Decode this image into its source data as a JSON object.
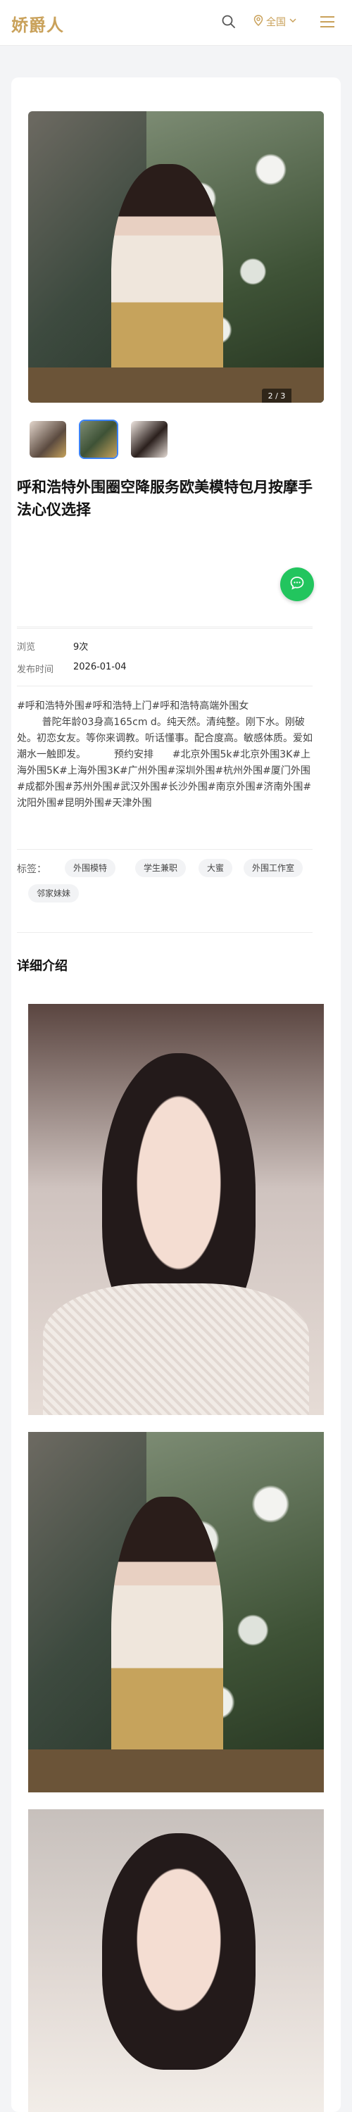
{
  "header": {
    "logo": "娇爵人",
    "location": "全国",
    "icons": {
      "search": "search-icon",
      "location": "map-pin-icon",
      "dropdown": "chevron-down-icon",
      "menu": "menu-icon"
    }
  },
  "gallery": {
    "counter": "2 / 3",
    "thumbnails": [
      {
        "name": "thumbnail-1",
        "active": false
      },
      {
        "name": "thumbnail-2",
        "active": true
      },
      {
        "name": "thumbnail-3",
        "active": false
      }
    ]
  },
  "post": {
    "title": "呼和浩特外围圈空降服务欧美模特包月按摩手法心仪选择",
    "views_label": "浏览",
    "views_value": "9次",
    "date_label": "发布时间",
    "date_value": "2026-01-04",
    "description": "#呼和浩特外围#呼和浩特上门#呼和浩特高端外围女\n        普陀年龄03身高165cm d。纯天然。清纯整。刚下水。刚破处。初恋女友。等你来调教。听话懂事。配合度高。敏感体质。爱如潮水一触即发。         预约安排      #北京外围5k#北京外围3K#上海外围5K#上海外围3K#广州外围#深圳外围#杭州外围#厦门外围#成都外围#苏州外围#武汉外围#长沙外围#南京外围#济南外围#沈阳外围#昆明外围#天津外围",
    "tags_label": "标签：",
    "tags": [
      "外围模特",
      "学生兼职",
      "大蜜",
      "外围工作室",
      "邻家妹妹"
    ],
    "details_title": "详细介绍"
  },
  "colors": {
    "accent": "#c9a15a",
    "chat_button": "#22c55e",
    "active_thumb_border": "#3b82f6"
  }
}
